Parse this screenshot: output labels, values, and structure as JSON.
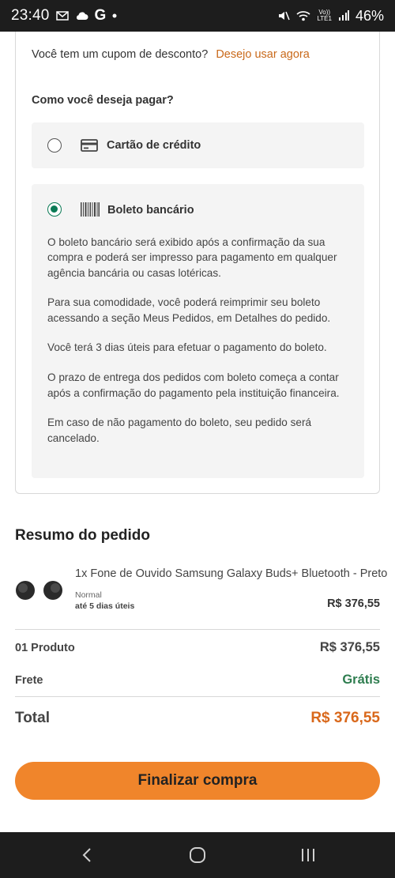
{
  "status_bar": {
    "time": "23:40",
    "left_icons": [
      "gmail-icon",
      "cloud-icon",
      "google-icon",
      "dot-icon"
    ],
    "right_icons": [
      "mute-icon",
      "wifi-icon",
      "volte-icon",
      "signal-icon"
    ],
    "volte_label_top": "Vo))",
    "volte_label_bottom": "LTE1",
    "battery": "46%"
  },
  "coupon": {
    "question": "Você tem um cupom de desconto?",
    "link": "Desejo usar agora"
  },
  "payment": {
    "title": "Como você deseja pagar?",
    "options": [
      {
        "label": "Cartão de crédito",
        "icon": "credit-card-icon",
        "selected": false
      },
      {
        "label": "Boleto bancário",
        "icon": "barcode-icon",
        "selected": true
      }
    ],
    "boleto_paragraphs": [
      "O boleto bancário será exibido após a confirmação da sua compra e poderá ser impresso para pagamento em qualquer agência bancária ou casas lotéricas.",
      "Para sua comodidade, você poderá reimprimir seu boleto acessando a seção Meus Pedidos, em Detalhes do pedido.",
      "Você terá 3 dias úteis para efetuar o pagamento do boleto.",
      "O prazo de entrega dos pedidos com boleto começa a contar após a confirmação do pagamento pela instituição financeira.",
      "Em caso de não pagamento do boleto, seu pedido será cancelado."
    ]
  },
  "summary": {
    "title": "Resumo do pedido",
    "product": {
      "name": "1x Fone de Ouvido Samsung Galaxy Buds+ Bluetooth - Preto",
      "shipping_type": "Normal",
      "shipping_days": "até 5 dias úteis",
      "price": "R$ 376,55"
    },
    "products_label": "01 Produto",
    "products_value": "R$ 376,55",
    "shipping_label": "Frete",
    "shipping_value": "Grátis",
    "total_label": "Total",
    "total_value": "R$ 376,55"
  },
  "checkout_button": "Finalizar compra",
  "colors": {
    "accent_orange": "#f0852b",
    "link_orange": "#c9691a",
    "total_orange": "#d9681b",
    "free_green": "#2e7d4f",
    "radio_green": "#0a7a55"
  },
  "nav_icons": [
    "back-icon",
    "home-icon",
    "recents-icon"
  ]
}
